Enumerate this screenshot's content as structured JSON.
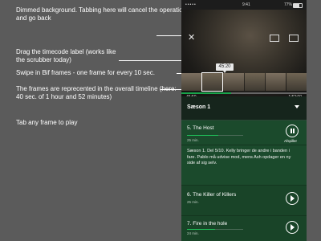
{
  "annotations": [
    {
      "text": "Dimmed background. Tabbing here will cancel the operation and go back"
    },
    {
      "text": "Drag the timecode label (works like the scrubber today)"
    },
    {
      "text": "Swipe in Bif frames - one frame for every 10 sec."
    },
    {
      "text": "The frames are reprecented in the overall timeline (here: 40 sec. of 1 hour and 52 minutes)"
    },
    {
      "text": "Tab any frame to play"
    }
  ],
  "status": {
    "left": "•••••",
    "wifi": "wifi-icon",
    "center": "9:41",
    "right": "77%"
  },
  "player": {
    "timecode": "45:20",
    "elapsed": "45:50",
    "total": "1:52:00",
    "progress": 0.4,
    "frame_count": 6,
    "selected_frame": 1
  },
  "season": {
    "label": "Sæson 1"
  },
  "episodes": [
    {
      "title": "5. The Host",
      "duration": "25 min.",
      "progress": 0.55,
      "action_label": "Afspiller",
      "description": "Sæson 1. Del 5/10. Kelly bringer de andre i banden i fare. Pablo må udvise mod, mens Ash opdager en ny side af sig selv."
    },
    {
      "title": "6. The Killer of Killers",
      "duration": "25 min.",
      "progress": 0
    },
    {
      "title": "7. Fire in the hole",
      "duration": "24 min.",
      "progress": 0.5
    }
  ],
  "colors": {
    "accent": "#20c25a",
    "panel": "#1b4a2c",
    "page_bg": "#5b5b5b"
  }
}
